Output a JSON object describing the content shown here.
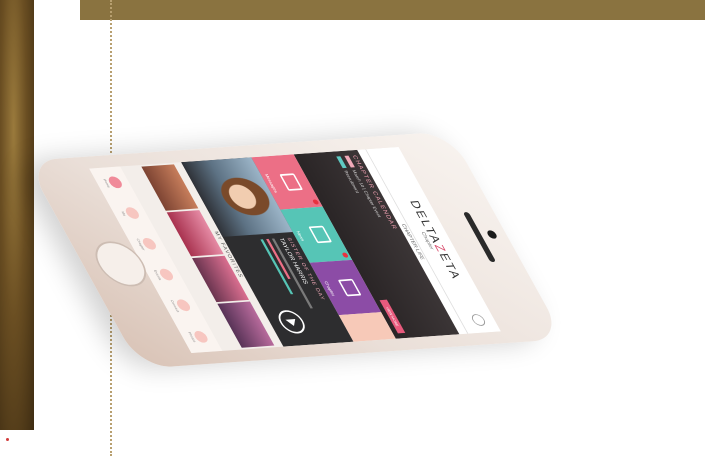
{
  "app": {
    "brand_left": "DELTA",
    "brand_mid": "Z",
    "brand_right": "ETA",
    "brand_sub": "Chapter",
    "chapter_label": "CHAPTER LIFE"
  },
  "calendar": {
    "title": "CHAPTER CALENDAR",
    "line1": "March 10  |  Chapter Event",
    "line2": "Recruitment",
    "button": "VIEW MORE"
  },
  "tiles": [
    {
      "label": "Messages"
    },
    {
      "label": "News"
    },
    {
      "label": "Chapter"
    },
    {
      "label": ""
    }
  ],
  "video": {
    "heading": "SISTER OF THE DAY",
    "name": "TAYLOR HARRIS"
  },
  "favorites": {
    "title": "MY FAVORITES"
  },
  "dock": [
    {
      "label": "Home"
    },
    {
      "label": "Me"
    },
    {
      "label": "Chapter"
    },
    {
      "label": "Events"
    },
    {
      "label": "Connect"
    },
    {
      "label": "Photos"
    }
  ],
  "colors": {
    "accent": "#ec6f86",
    "teal": "#56c5b6",
    "purple": "#8c4ca6"
  }
}
